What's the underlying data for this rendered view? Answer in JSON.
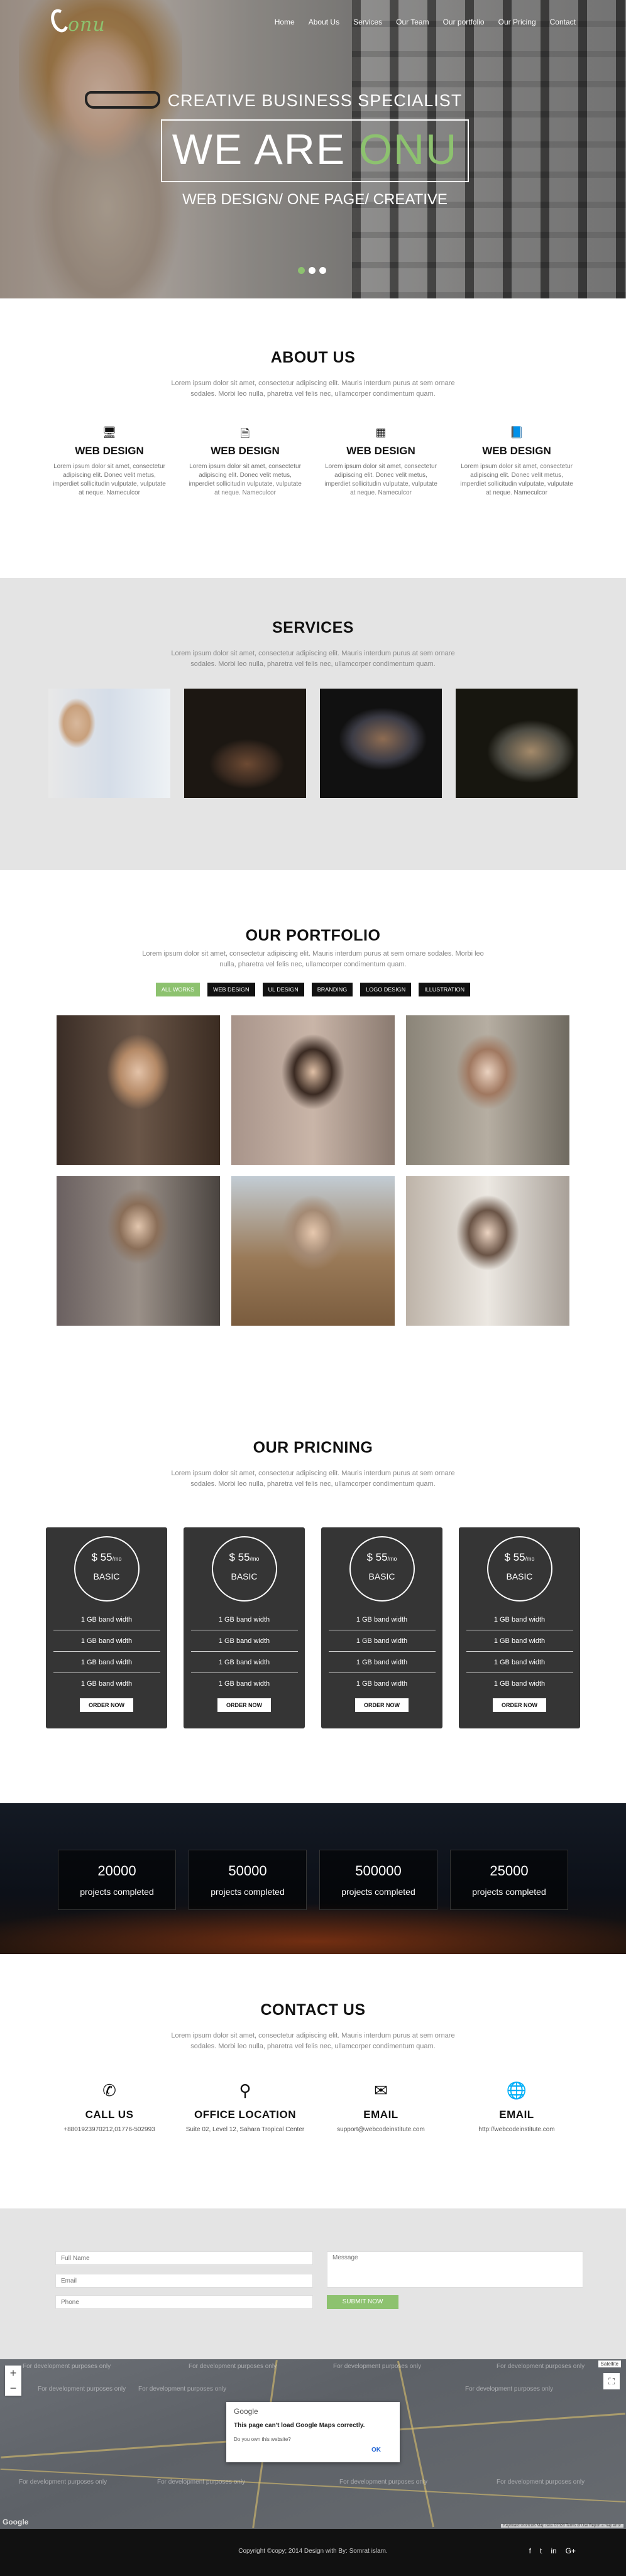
{
  "logo": {
    "text": "onu"
  },
  "nav": [
    "Home",
    "About Us",
    "Services",
    "Our Team",
    "Our portfolio",
    "Our Pricing",
    "Contact"
  ],
  "hero": {
    "subtitle": "CREATIVE BUSINESS SPECIALIST",
    "headline_a": "WE ARE",
    "headline_b": "ONU",
    "tagline": "WEB DESIGN/ ONE PAGE/ CREATIVE"
  },
  "about": {
    "title": "ABOUT US",
    "intro": "Lorem ipsum dolor sit amet, consectetur adipiscing elit. Mauris interdum purus at sem ornare sodales. Morbi leo nulla, pharetra vel felis nec, ullamcorper condimentum quam.",
    "features": [
      {
        "icon": "monitor-icon",
        "title": "WEB DESIGN",
        "text": "Lorem ipsum dolor sit amet, consectetur adipiscing elit. Donec velit metus, imperdiet sollicitudin vulputate, vulputate at neque. Nameculcor"
      },
      {
        "icon": "documents-icon",
        "title": "WEB DESIGN",
        "text": "Lorem ipsum dolor sit amet, consectetur adipiscing elit. Donec velit metus, imperdiet sollicitudin vulputate, vulputate at neque. Nameculcor"
      },
      {
        "icon": "windows-icon",
        "title": "WEB DESIGN",
        "text": "Lorem ipsum dolor sit amet, consectetur adipiscing elit. Donec velit metus, imperdiet sollicitudin vulputate, vulputate at neque. Nameculcor"
      },
      {
        "icon": "book-icon",
        "title": "WEB DESIGN",
        "text": "Lorem ipsum dolor sit amet, consectetur adipiscing elit. Donec velit metus, imperdiet sollicitudin vulputate, vulputate at neque. Nameculcor"
      }
    ]
  },
  "services": {
    "title": "SERVICES",
    "intro": "Lorem ipsum dolor sit amet, consectetur adipiscing elit. Mauris interdum purus at sem ornare sodales. Morbi leo nulla, pharetra vel felis nec, ullamcorper condimentum quam."
  },
  "portfolio": {
    "title": "OUR PORTFOLIO",
    "intro": "Lorem ipsum dolor sit amet, consectetur adipiscing elit. Mauris interdum purus at sem ornare sodales. Morbi leo nulla, pharetra vel felis nec, ullamcorper condimentum quam.",
    "filters": [
      "ALL WORKS",
      "WEB DESIGN",
      "UL DESIGN",
      "BRANDING",
      "LOGO DESIGN",
      "ILLUSTRATION"
    ]
  },
  "pricing": {
    "title": "OUR PRICNING",
    "intro": "Lorem ipsum dolor sit amet, consectetur adipiscing elit. Mauris interdum purus at sem ornare sodales. Morbi leo nulla, pharetra vel felis nec, ullamcorper condimentum quam.",
    "plans": [
      {
        "price": "$ 55",
        "per": "/mo",
        "name": "BASIC",
        "features": [
          "1 GB band width",
          "1 GB band width",
          "1 GB band width",
          "1 GB band width"
        ],
        "cta": "ORDER NOW"
      },
      {
        "price": "$ 55",
        "per": "/mo",
        "name": "BASIC",
        "features": [
          "1 GB band width",
          "1 GB band width",
          "1 GB band width",
          "1 GB band width"
        ],
        "cta": "ORDER NOW"
      },
      {
        "price": "$ 55",
        "per": "/mo",
        "name": "BASIC",
        "features": [
          "1 GB band width",
          "1 GB band width",
          "1 GB band width",
          "1 GB band width"
        ],
        "cta": "ORDER NOW"
      },
      {
        "price": "$ 55",
        "per": "/mo",
        "name": "BASIC",
        "features": [
          "1 GB band width",
          "1 GB band width",
          "1 GB band width",
          "1 GB band width"
        ],
        "cta": "ORDER NOW"
      }
    ]
  },
  "stats": [
    {
      "num": "20000",
      "label": "projects completed"
    },
    {
      "num": "50000",
      "label": "projects completed"
    },
    {
      "num": "500000",
      "label": "projects completed"
    },
    {
      "num": "25000",
      "label": "projects completed"
    }
  ],
  "contact": {
    "title": "CONTACT US",
    "intro": "Lorem ipsum dolor sit amet, consectetur adipiscing elit. Mauris interdum purus at sem ornare sodales. Morbi leo nulla, pharetra vel felis nec, ullamcorper condimentum quam.",
    "items": [
      {
        "icon": "phone-icon",
        "title": "CALL US",
        "text": "+8801923970212,01776-502993"
      },
      {
        "icon": "location-icon",
        "title": "OFFICE LOCATION",
        "text": "Suite 02, Level 12, Sahara Tropical Center"
      },
      {
        "icon": "envelope-icon",
        "title": "EMAIL",
        "text": "support@webcodeinstitute.com"
      },
      {
        "icon": "globe-icon",
        "title": "EMAIL",
        "text": "http://webcodeinstitute.com"
      }
    ]
  },
  "form": {
    "name_placeholder": "Full Name",
    "email_placeholder": "Email",
    "phone_placeholder": "Phone",
    "message_placeholder": "Message",
    "submit": "SUBMIT NOW"
  },
  "map": {
    "dev_text": "For development purposes only",
    "dialog_brand": "Google",
    "dialog_message": "This page can't load Google Maps correctly.",
    "dialog_question": "Do you own this website?",
    "dialog_ok": "OK",
    "type_label": "Satellite",
    "logo": "Google",
    "footer_text": "Keyboard shortcuts  Map data ©2020  Terms of Use  Report a map error"
  },
  "footer": {
    "copyright": "Copyright ©copy; 2014 Design with By: Somrat islam.",
    "social": [
      "f",
      "t",
      "in",
      "G+"
    ]
  },
  "colors": {
    "accent": "#8dc26f",
    "dark": "#353535",
    "grey_band": "#e4e4e4"
  }
}
